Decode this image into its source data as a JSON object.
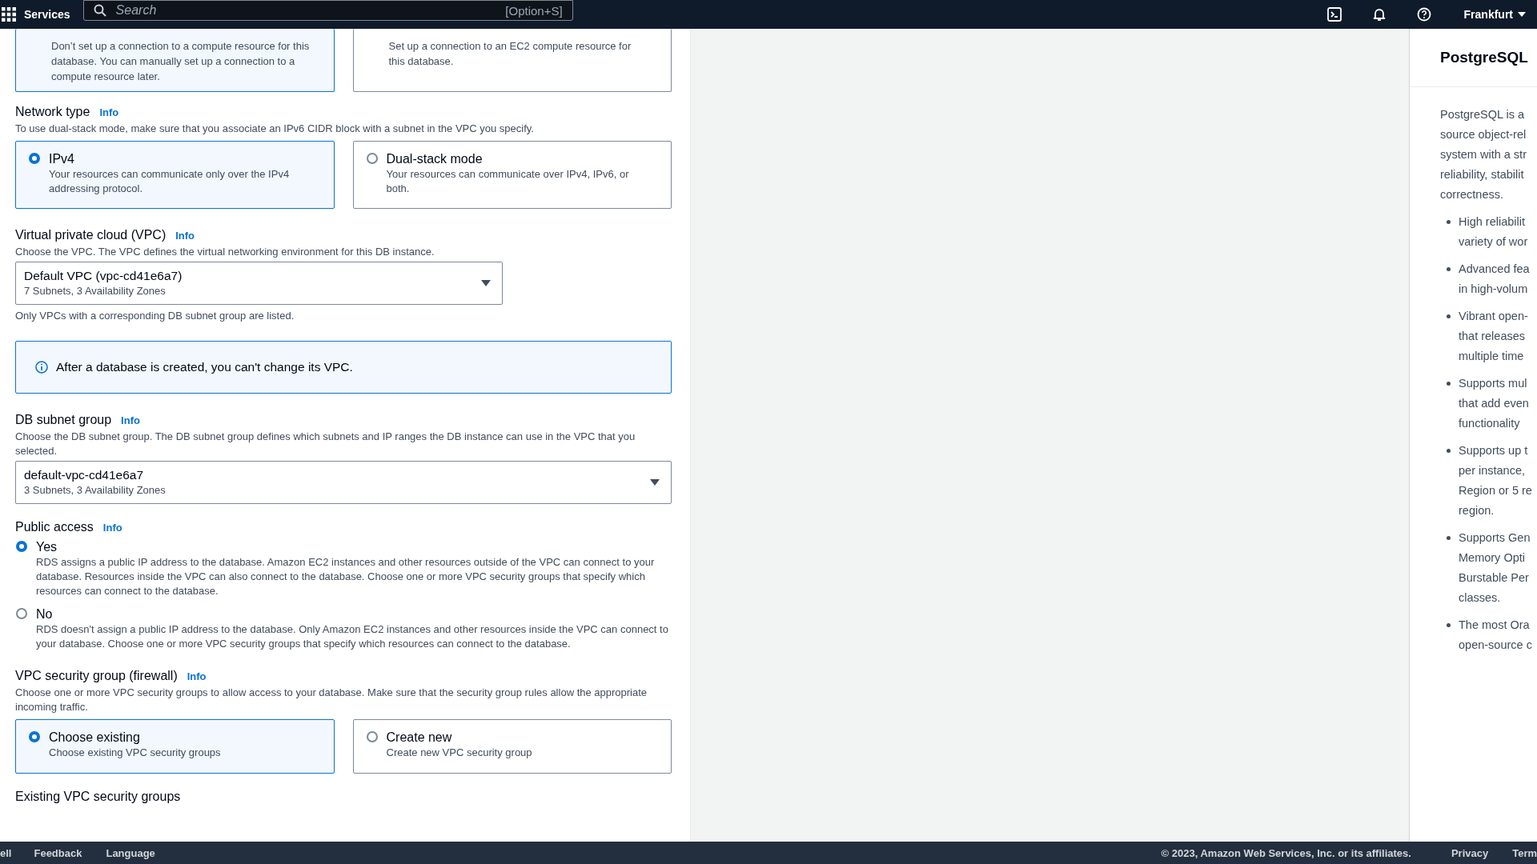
{
  "top_bar": {
    "services": "Services",
    "search": {
      "placeholder": "Search",
      "shortcut": "[Option+S]"
    },
    "region": "Frankfurt"
  },
  "connection_options": [
    {
      "description": "Don’t set up a connection to a compute resource for this database. You can manually set up a connection to a compute resource later.",
      "selected": true
    },
    {
      "description": "Set up a connection to an EC2 compute resource for this database.",
      "selected": false
    }
  ],
  "network_type": {
    "label": "Network type",
    "info": "Info",
    "description": "To use dual-stack mode, make sure that you associate an IPv6 CIDR block with a subnet in the VPC you specify.",
    "options": [
      {
        "title": "IPv4",
        "description": "Your resources can communicate only over the IPv4 addressing protocol.",
        "selected": true
      },
      {
        "title": "Dual-stack mode",
        "description": "Your resources can communicate over IPv4, IPv6, or both.",
        "selected": false
      }
    ]
  },
  "vpc": {
    "label": "Virtual private cloud (VPC)",
    "info": "Info",
    "description": "Choose the VPC. The VPC defines the virtual networking environment for this DB instance.",
    "select": {
      "value": "Default VPC (vpc-cd41e6a7)",
      "detail": "7 Subnets, 3 Availability Zones"
    },
    "note": "Only VPCs with a corresponding DB subnet group are listed."
  },
  "alert": {
    "text": "After a database is created, you can't change its VPC."
  },
  "subnet_group": {
    "label": "DB subnet group",
    "info": "Info",
    "description": "Choose the DB subnet group. The DB subnet group defines which subnets and IP ranges the DB instance can use in the VPC that you selected.",
    "select": {
      "value": "default-vpc-cd41e6a7",
      "detail": "3 Subnets, 3 Availability Zones"
    }
  },
  "public_access": {
    "label": "Public access",
    "info": "Info",
    "options": [
      {
        "title": "Yes",
        "description": "RDS assigns a public IP address to the database. Amazon EC2 instances and other resources outside of the VPC can connect to your database. Resources inside the VPC can also connect to the database. Choose one or more VPC security groups that specify which resources can connect to the database.",
        "selected": true
      },
      {
        "title": "No",
        "description": "RDS doesn't assign a public IP address to the database. Only Amazon EC2 instances and other resources inside the VPC can connect to your database. Choose one or more VPC security groups that specify which resources can connect to the database.",
        "selected": false
      }
    ]
  },
  "security_group": {
    "label": "VPC security group (firewall)",
    "info": "Info",
    "description": "Choose one or more VPC security groups to allow access to your database. Make sure that the security group rules allow the appropriate incoming traffic.",
    "options": [
      {
        "title": "Choose existing",
        "description": "Choose existing VPC security groups",
        "selected": true
      },
      {
        "title": "Create new",
        "description": "Create new VPC security group",
        "selected": false
      }
    ]
  },
  "existing_groups": {
    "label": "Existing VPC security groups"
  },
  "help_panel": {
    "title": "PostgreSQL",
    "intro": [
      "PostgreSQL is a",
      "source object-rel",
      "system with a str",
      "reliability, stabilit",
      "correctness."
    ],
    "bullets": [
      [
        "High reliabilit",
        "variety of wor"
      ],
      [
        "Advanced fea",
        "in high-volum"
      ],
      [
        "Vibrant open-",
        "that releases",
        "multiple time"
      ],
      [
        "Supports mul",
        "that add even",
        "functionality"
      ],
      [
        "Supports up t",
        "per instance,",
        "Region or 5 re",
        "region."
      ],
      [
        "Supports Gen",
        "Memory Opti",
        "Burstable Per",
        "classes."
      ],
      [
        "The most Ora",
        "open-source c"
      ]
    ]
  },
  "footer": {
    "left": [
      "ell",
      "Feedback",
      "Language"
    ],
    "copyright": "© 2023, Amazon Web Services, Inc. or its affiliates.",
    "links": [
      "Privacy",
      "Term"
    ]
  }
}
